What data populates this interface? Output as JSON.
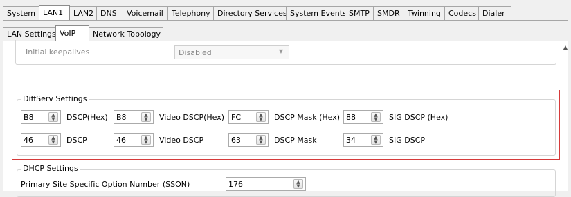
{
  "tabs": [
    "System",
    "LAN1",
    "LAN2",
    "DNS",
    "Voicemail",
    "Telephony",
    "Directory Services",
    "System Events",
    "SMTP",
    "SMDR",
    "Twinning",
    "Codecs",
    "Dialer"
  ],
  "subtabs": [
    "LAN Settings",
    "VoIP",
    "Network Topology"
  ],
  "keepalives": {
    "label": "Initial keepalives",
    "value": "Disabled"
  },
  "diffserv": {
    "title": "DiffServ Settings",
    "row1": [
      {
        "value": "B8",
        "label": "DSCP(Hex)"
      },
      {
        "value": "B8",
        "label": "Video DSCP(Hex)"
      },
      {
        "value": "FC",
        "label": "DSCP Mask (Hex)"
      },
      {
        "value": "88",
        "label": "SIG DSCP (Hex)"
      }
    ],
    "row2": [
      {
        "value": "46",
        "label": "DSCP"
      },
      {
        "value": "46",
        "label": "Video DSCP"
      },
      {
        "value": "63",
        "label": "DSCP Mask"
      },
      {
        "value": "34",
        "label": "SIG DSCP"
      }
    ]
  },
  "dhcp": {
    "title": "DHCP Settings",
    "sson_label": "Primary Site Specific Option Number (SSON)",
    "sson_value": "176"
  }
}
